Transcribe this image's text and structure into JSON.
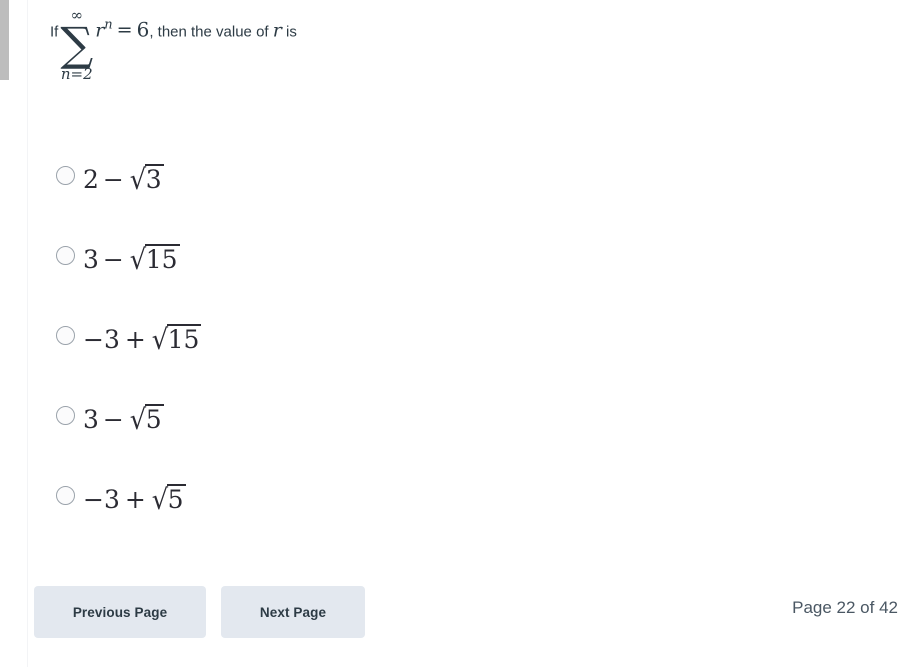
{
  "scrollbar": {
    "thumb_color": "#bdbdbd"
  },
  "question": {
    "lead_text": "If",
    "summation": {
      "upper_limit": "∞",
      "symbol": "∑",
      "lower_limit": "n=2"
    },
    "term_base": "r",
    "term_exponent": "n",
    "equals_sign": "=",
    "sum_value": "6",
    "comma": ",",
    "trailing_text": "then the value of",
    "trailing_variable": "r",
    "trailing_tail": "is"
  },
  "options": [
    {
      "id": "option-a",
      "lead": "2",
      "operator": "−",
      "radicand": "3",
      "selected": false,
      "text": "2 − √3"
    },
    {
      "id": "option-b",
      "lead": "3",
      "operator": "−",
      "radicand": "15",
      "selected": false,
      "text": "3 − √15"
    },
    {
      "id": "option-c",
      "lead": "−3",
      "operator": "+",
      "radicand": "15",
      "selected": false,
      "text": "−3 + √15"
    },
    {
      "id": "option-d",
      "lead": "3",
      "operator": "−",
      "radicand": "5",
      "selected": false,
      "text": "3 − √5"
    },
    {
      "id": "option-e",
      "lead": "−3",
      "operator": "+",
      "radicand": "5",
      "selected": false,
      "text": "−3 + √5"
    }
  ],
  "footer": {
    "previous_label": "Previous Page",
    "next_label": "Next Page",
    "page_indicator": "Page 22 of 42",
    "button_color": "#e3e8ef"
  },
  "radical_glyph": "√"
}
